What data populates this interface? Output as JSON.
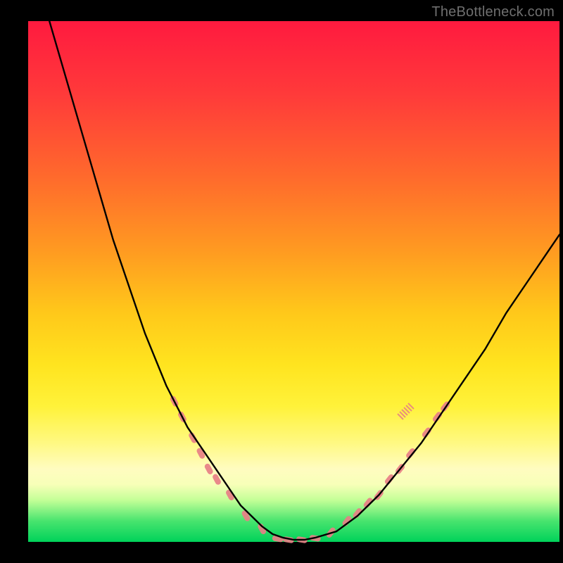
{
  "watermark": "TheBottleneck.com",
  "chart_data": {
    "type": "line",
    "title": "",
    "xlabel": "",
    "ylabel": "",
    "xlim": [
      0,
      100
    ],
    "ylim": [
      0,
      100
    ],
    "series": [
      {
        "name": "bottleneck-curve",
        "x": [
          4,
          6,
          8,
          10,
          12,
          14,
          16,
          18,
          20,
          22,
          24,
          26,
          28,
          30,
          32,
          34,
          36,
          38,
          40,
          42,
          44,
          46,
          48,
          50,
          52,
          54,
          58,
          62,
          66,
          70,
          74,
          78,
          82,
          86,
          90,
          94,
          98,
          100
        ],
        "y": [
          100,
          93,
          86,
          79,
          72,
          65,
          58,
          52,
          46,
          40,
          35,
          30,
          26,
          22,
          19,
          16,
          13,
          10,
          7,
          5,
          3,
          1.5,
          0.8,
          0.4,
          0.4,
          0.8,
          2,
          5,
          9,
          14,
          19,
          25,
          31,
          37,
          44,
          50,
          56,
          59
        ]
      }
    ],
    "notch_markers": {
      "name": "pink-notches",
      "points": [
        {
          "side": "left",
          "x": 27.5,
          "y": 27
        },
        {
          "side": "left",
          "x": 29,
          "y": 24
        },
        {
          "side": "left",
          "x": 31,
          "y": 20
        },
        {
          "side": "left",
          "x": 32.5,
          "y": 17
        },
        {
          "side": "left",
          "x": 34,
          "y": 14
        },
        {
          "side": "left",
          "x": 35.5,
          "y": 12
        },
        {
          "side": "left",
          "x": 38,
          "y": 9
        },
        {
          "side": "left",
          "x": 41,
          "y": 5
        },
        {
          "side": "left",
          "x": 44,
          "y": 2.5
        },
        {
          "side": "floor",
          "x": 47,
          "y": 0.6
        },
        {
          "side": "floor",
          "x": 49,
          "y": 0.4
        },
        {
          "side": "floor",
          "x": 51.5,
          "y": 0.4
        },
        {
          "side": "floor",
          "x": 54,
          "y": 0.7
        },
        {
          "side": "right",
          "x": 57,
          "y": 1.8
        },
        {
          "side": "right",
          "x": 60,
          "y": 4
        },
        {
          "side": "right",
          "x": 62,
          "y": 5.5
        },
        {
          "side": "right",
          "x": 64,
          "y": 7.5
        },
        {
          "side": "right",
          "x": 66,
          "y": 9
        },
        {
          "side": "right",
          "x": 68,
          "y": 12
        },
        {
          "side": "right",
          "x": 70,
          "y": 14
        },
        {
          "side": "right",
          "x": 72,
          "y": 17
        },
        {
          "side": "right",
          "x": 75,
          "y": 21
        },
        {
          "side": "right",
          "x": 77,
          "y": 24
        },
        {
          "side": "right",
          "x": 78.5,
          "y": 26
        }
      ]
    },
    "tick_cluster": {
      "x": 71,
      "y": 25,
      "note": "small jagged tick marks on right branch"
    },
    "colors": {
      "curve": "#000000",
      "markers": "#e77f85",
      "gradient_top": "#ff1a3f",
      "gradient_mid": "#fff23a",
      "gradient_bottom": "#00d25a",
      "background": "#000000"
    }
  }
}
